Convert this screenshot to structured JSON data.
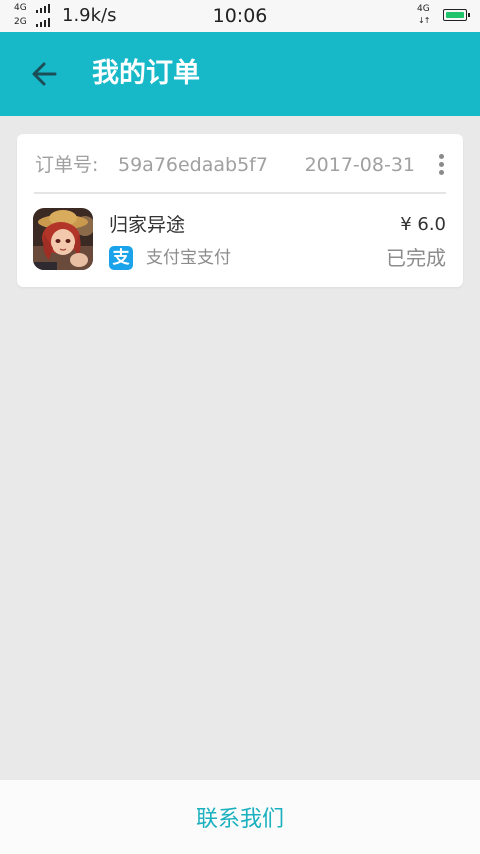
{
  "status_bar": {
    "net_left_top": "4G",
    "net_left_bottom": "2G",
    "net_speed": "1.9k/s",
    "time": "10:06",
    "net_right": "4G",
    "net_right_arrows": "↓↑",
    "battery_color": "#1fc36b"
  },
  "app_bar": {
    "title": "我的订单",
    "back_icon": "arrow-left-icon",
    "background": "#17b8c8"
  },
  "order": {
    "order_no_label": "订单号:",
    "order_no": "59a76edaab5f7",
    "date": "2017-08-31",
    "more_icon": "more-vertical-icon",
    "product_name": "归家异途",
    "price": "¥ 6.0",
    "pay_icon_glyph": "支",
    "pay_method": "支付宝支付",
    "status": "已完成"
  },
  "bottom": {
    "contact_label": "联系我们"
  }
}
